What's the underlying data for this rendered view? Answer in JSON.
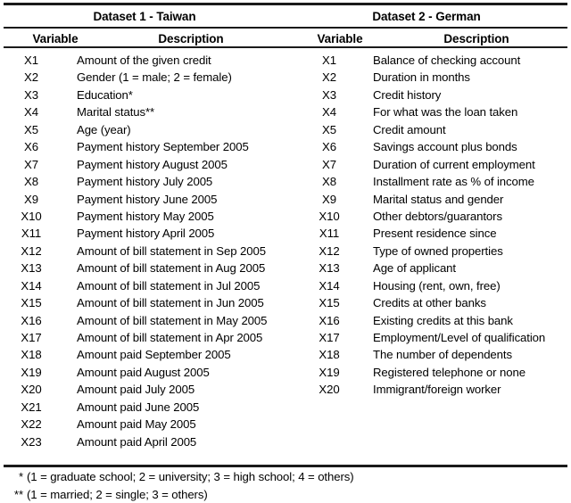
{
  "table": {
    "datasets": [
      {
        "title": "Dataset 1 - Taiwan",
        "columns": {
          "variable": "Variable",
          "description": "Description"
        },
        "rows": [
          {
            "variable": "X1",
            "description": "Amount of the given credit"
          },
          {
            "variable": "X2",
            "description": "Gender (1 = male; 2 = female)"
          },
          {
            "variable": "X3",
            "description": "Education*"
          },
          {
            "variable": "X4",
            "description": "Marital status**"
          },
          {
            "variable": "X5",
            "description": "Age (year)"
          },
          {
            "variable": "X6",
            "description": "Payment history September 2005"
          },
          {
            "variable": "X7",
            "description": "Payment history August 2005"
          },
          {
            "variable": "X8",
            "description": "Payment history July 2005"
          },
          {
            "variable": "X9",
            "description": "Payment history June 2005"
          },
          {
            "variable": "X10",
            "description": "Payment history May 2005"
          },
          {
            "variable": "X11",
            "description": "Payment history April 2005"
          },
          {
            "variable": "X12",
            "description": "Amount of bill statement in Sep 2005"
          },
          {
            "variable": "X13",
            "description": "Amount of bill statement in Aug 2005"
          },
          {
            "variable": "X14",
            "description": "Amount of bill statement in Jul 2005"
          },
          {
            "variable": "X15",
            "description": "Amount of bill statement in Jun 2005"
          },
          {
            "variable": "X16",
            "description": "Amount of bill statement in May 2005"
          },
          {
            "variable": "X17",
            "description": "Amount of bill statement in Apr 2005"
          },
          {
            "variable": "X18",
            "description": "Amount paid September 2005"
          },
          {
            "variable": "X19",
            "description": "Amount paid August 2005"
          },
          {
            "variable": "X20",
            "description": "Amount paid July 2005"
          },
          {
            "variable": "X21",
            "description": "Amount paid June 2005"
          },
          {
            "variable": "X22",
            "description": "Amount paid May 2005"
          },
          {
            "variable": "X23",
            "description": "Amount paid April 2005"
          }
        ]
      },
      {
        "title": "Dataset 2 - German",
        "columns": {
          "variable": "Variable",
          "description": "Description"
        },
        "rows": [
          {
            "variable": "X1",
            "description": "Balance of checking account"
          },
          {
            "variable": "X2",
            "description": "Duration in months"
          },
          {
            "variable": "X3",
            "description": "Credit history"
          },
          {
            "variable": "X4",
            "description": "For what was the loan taken"
          },
          {
            "variable": "X5",
            "description": "Credit amount"
          },
          {
            "variable": "X6",
            "description": "Savings account plus bonds"
          },
          {
            "variable": "X7",
            "description": "Duration of current employment"
          },
          {
            "variable": "X8",
            "description": "Installment rate as % of income"
          },
          {
            "variable": "X9",
            "description": "Marital status and gender"
          },
          {
            "variable": "X10",
            "description": "Other debtors/guarantors"
          },
          {
            "variable": "X11",
            "description": "Present residence since"
          },
          {
            "variable": "X12",
            "description": "Type of owned properties"
          },
          {
            "variable": "X13",
            "description": "Age of applicant"
          },
          {
            "variable": "X14",
            "description": "Housing (rent, own, free)"
          },
          {
            "variable": "X15",
            "description": "Credits at other banks"
          },
          {
            "variable": "X16",
            "description": "Existing credits at this bank"
          },
          {
            "variable": "X17",
            "description": "Employment/Level of qualification"
          },
          {
            "variable": "X18",
            "description": "The number of dependents"
          },
          {
            "variable": "X19",
            "description": "Registered telephone or none"
          },
          {
            "variable": "X20",
            "description": "Immigrant/foreign worker"
          }
        ]
      }
    ],
    "footnotes": [
      {
        "mark": "*",
        "text": "(1 = graduate school; 2 = university; 3 = high school; 4 = others)"
      },
      {
        "mark": "**",
        "text": "(1 = married; 2 = single; 3 = others)"
      }
    ]
  }
}
